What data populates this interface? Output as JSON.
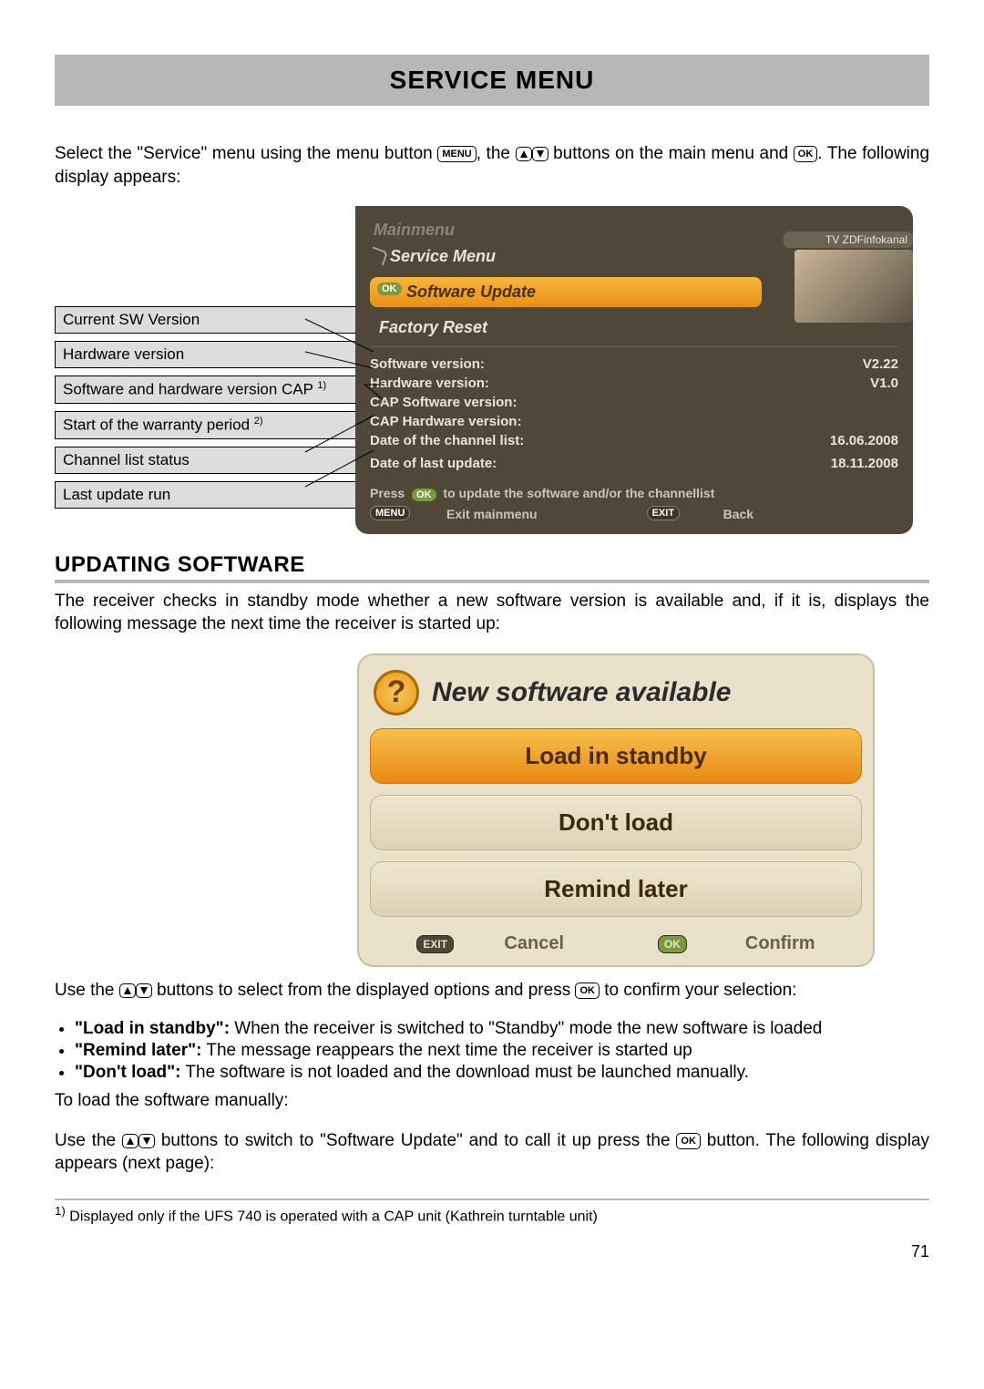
{
  "title": "SERVICE MENU",
  "intro_a": "Select the \"Service\" menu using the menu button ",
  "intro_b": ", the ",
  "intro_c": " buttons on the main menu and ",
  "intro_d": ". The following display appears:",
  "btn": {
    "menu": "MENU",
    "ok": "OK",
    "exit": "EXIT"
  },
  "callouts": [
    "Current SW Version",
    "Hardware version",
    "Software and hardware version CAP ",
    "Start of the warranty period ",
    "Channel list status",
    "Last update run"
  ],
  "callout_sup": {
    "c2": "1)",
    "c3": "2)"
  },
  "ss1": {
    "mainmenu": "Mainmenu",
    "service": "Service Menu",
    "channel_badge": "TV  ZDFinfokanal",
    "highlight": "Software Update",
    "item2": "Factory Reset",
    "rows": [
      {
        "l": "Software version:",
        "v": "V2.22"
      },
      {
        "l": "Hardware version:",
        "v": "V1.0"
      },
      {
        "l": "CAP  Software version:",
        "v": ""
      },
      {
        "l": "CAP  Hardware version:",
        "v": ""
      },
      {
        "l": "Date of the channel list:",
        "v": "16.06.2008"
      },
      {
        "l": "",
        "v": ""
      },
      {
        "l": "Date of last update:",
        "v": "18.11.2008"
      }
    ],
    "hint_a": "Press ",
    "hint_b": " to update the software and/or the channellist",
    "foot_menu": "Exit mainmenu",
    "foot_exit": "Back"
  },
  "section2": "UPDATING SOFTWARE",
  "para2": "The receiver checks in standby mode whether a new software version is available and, if it is, displays the following message the next time the receiver is started up:",
  "dialog": {
    "title": "New software available",
    "opt1": "Load in standby",
    "opt2": "Don't load",
    "opt3": "Remind later",
    "cancel": "Cancel",
    "confirm": "Confirm"
  },
  "after_a": "Use the ",
  "after_b": " buttons to select from the displayed options and press ",
  "after_c": " to confirm your selection:",
  "bullets": [
    {
      "b": "\"Load in standby\":",
      "t": " When the receiver is switched to \"Standby\" mode the new software is loaded"
    },
    {
      "b": "\"Remind later\":",
      "t": " The message reappears the next time the receiver is started up"
    },
    {
      "b": "\"Don't load\":",
      "t": " The software is not loaded and the download must be launched manually."
    }
  ],
  "para3": "To load the software manually:",
  "para4_a": "Use the ",
  "para4_b": " buttons to switch to \"Software Update\" and to call it up press the ",
  "para4_c": " button. The following display appears (next page):",
  "footnote_sup": "1)",
  "footnote": " Displayed only if the UFS 740 is operated with a CAP unit (Kathrein turntable unit)",
  "page": "71"
}
